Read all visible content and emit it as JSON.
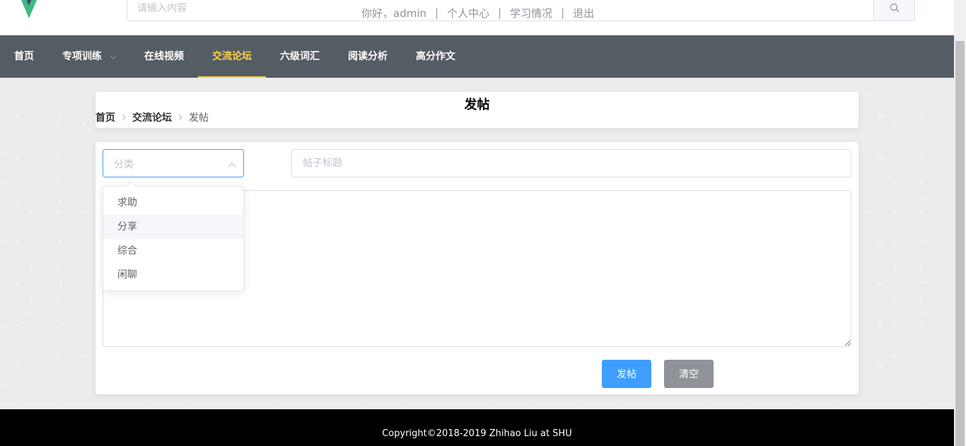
{
  "header": {
    "search_placeholder": "请输入内容",
    "greeting": "你好，admin",
    "links": [
      "个人中心",
      "学习情况",
      "退出"
    ],
    "separator": "|"
  },
  "nav": {
    "items": [
      {
        "label": "首页"
      },
      {
        "label": "专项训练"
      },
      {
        "label": "在线视频"
      },
      {
        "label": "交流论坛"
      },
      {
        "label": "六级词汇"
      },
      {
        "label": "阅读分析"
      },
      {
        "label": "高分作文"
      }
    ],
    "active_label": "交流论坛",
    "background": "#545c64",
    "active_color": "#ffd04b"
  },
  "page": {
    "title": "发帖",
    "breadcrumb": [
      "首页",
      "交流论坛",
      "发帖"
    ]
  },
  "form": {
    "category_placeholder": "分类",
    "title_placeholder": "帖子标题",
    "content_value": "",
    "post_button": "发帖",
    "clear_button": "清空",
    "category_options": [
      "求助",
      "分享",
      "综合",
      "闲聊"
    ],
    "hovered_option": "分享"
  },
  "footer": {
    "text": "Copyright©2018-2019 Zhihao Liu at SHU"
  },
  "colors": {
    "primary": "#409eff",
    "info": "#909399"
  }
}
